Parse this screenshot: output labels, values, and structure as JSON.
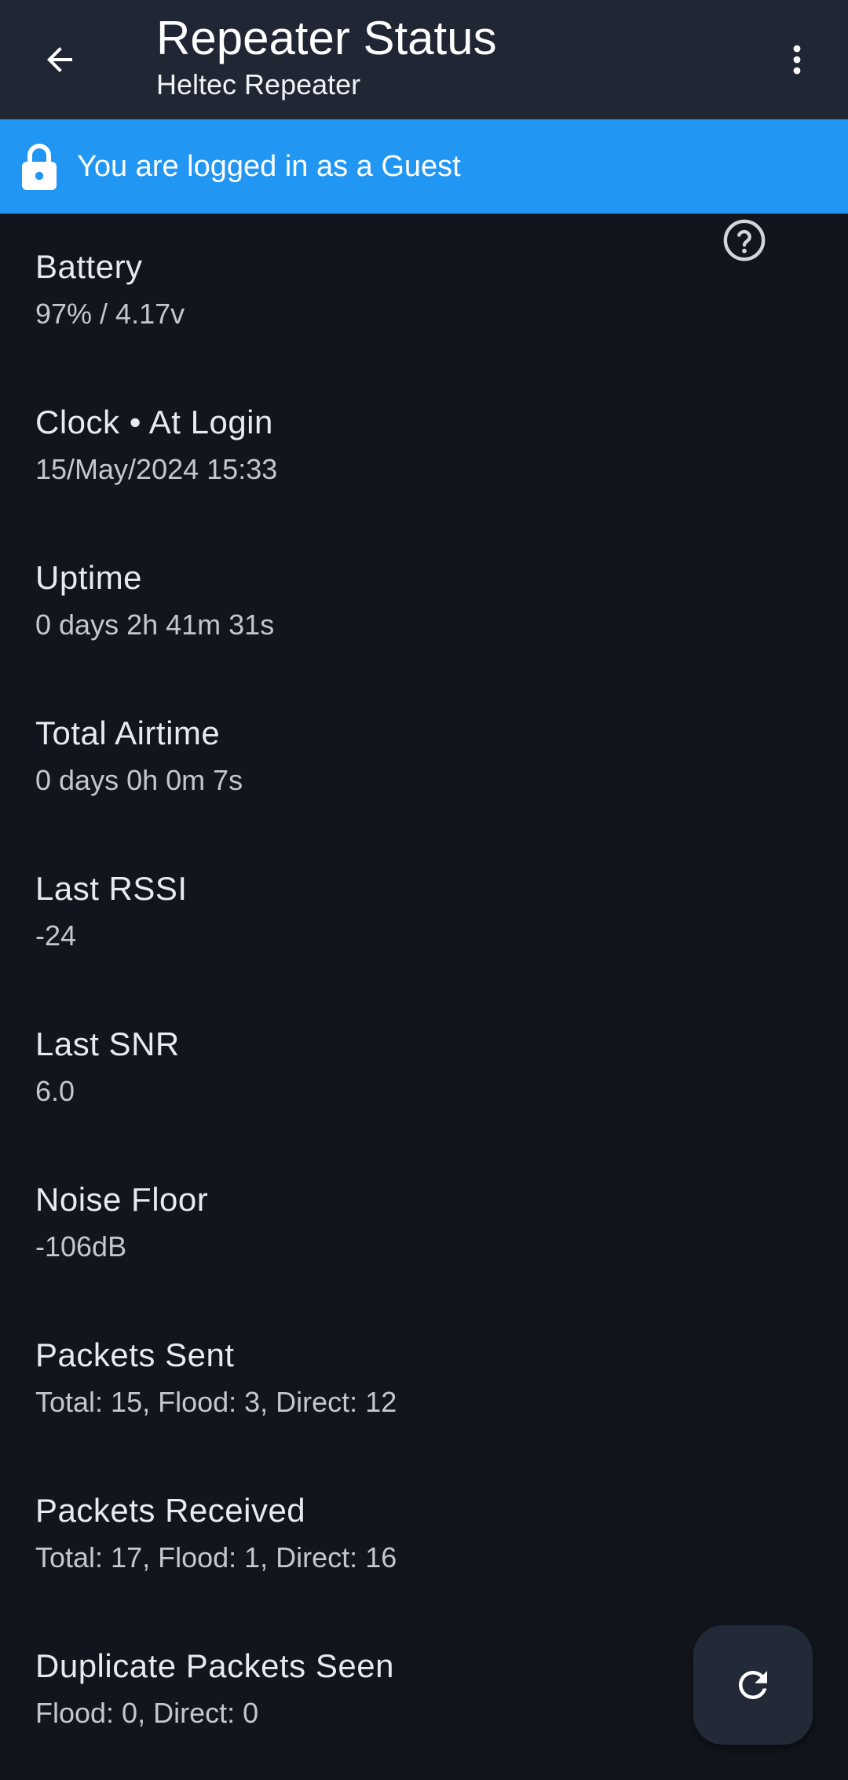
{
  "appbar": {
    "title": "Repeater Status",
    "subtitle": "Heltec Repeater",
    "back_icon": "arrow-back-icon",
    "menu_icon": "more-vertical-icon",
    "background": "#202633"
  },
  "banner": {
    "icon": "lock-icon",
    "text": "You are logged in as a Guest",
    "background": "#2196f3"
  },
  "status": [
    {
      "label": "Battery",
      "value": "97% / 4.17v"
    },
    {
      "label": "Clock • At Login",
      "value": "15/May/2024 15:33"
    },
    {
      "label": "Uptime",
      "value": "0 days 2h 41m 31s"
    },
    {
      "label": "Total Airtime",
      "value": "0 days 0h 0m 7s"
    },
    {
      "label": "Last RSSI",
      "value": "-24"
    },
    {
      "label": "Last SNR",
      "value": "6.0"
    },
    {
      "label": "Noise Floor",
      "value": "-106dB"
    },
    {
      "label": "Packets Sent",
      "value": "Total: 15, Flood: 3, Direct: 12"
    },
    {
      "label": "Packets Received",
      "value": "Total: 17, Flood: 1, Direct: 16"
    },
    {
      "label": "Duplicate Packets Seen",
      "value": "Flood: 0, Direct: 0"
    }
  ],
  "help_icon": "help-circle-icon",
  "fab_icon": "refresh-icon",
  "colors": {
    "page_background": "#12151d",
    "fab_background": "#232a37"
  }
}
